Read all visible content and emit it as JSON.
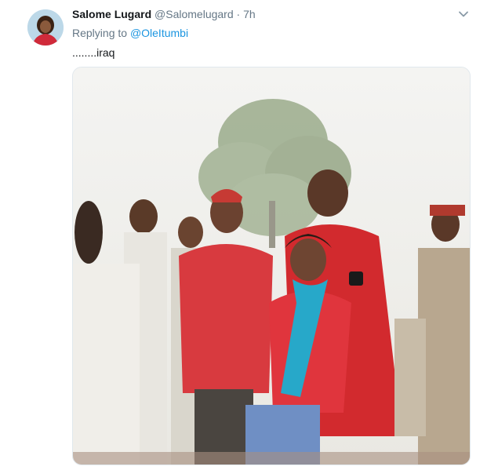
{
  "tweet": {
    "name": "Salome Lugard",
    "handle": "@Salomelugard",
    "separator": "·",
    "time": "7h",
    "reply_prefix": "Replying to",
    "reply_to": "@OleItumbi",
    "text": "........iraq"
  },
  "icons": {
    "menu": "chevron-down-icon",
    "avatar": "avatar"
  },
  "colors": {
    "link": "#1b95e0",
    "secondary_text": "#657786",
    "primary_text": "#14171a",
    "shirt_red": "#d5262b",
    "scarf": "#27a8c9"
  }
}
